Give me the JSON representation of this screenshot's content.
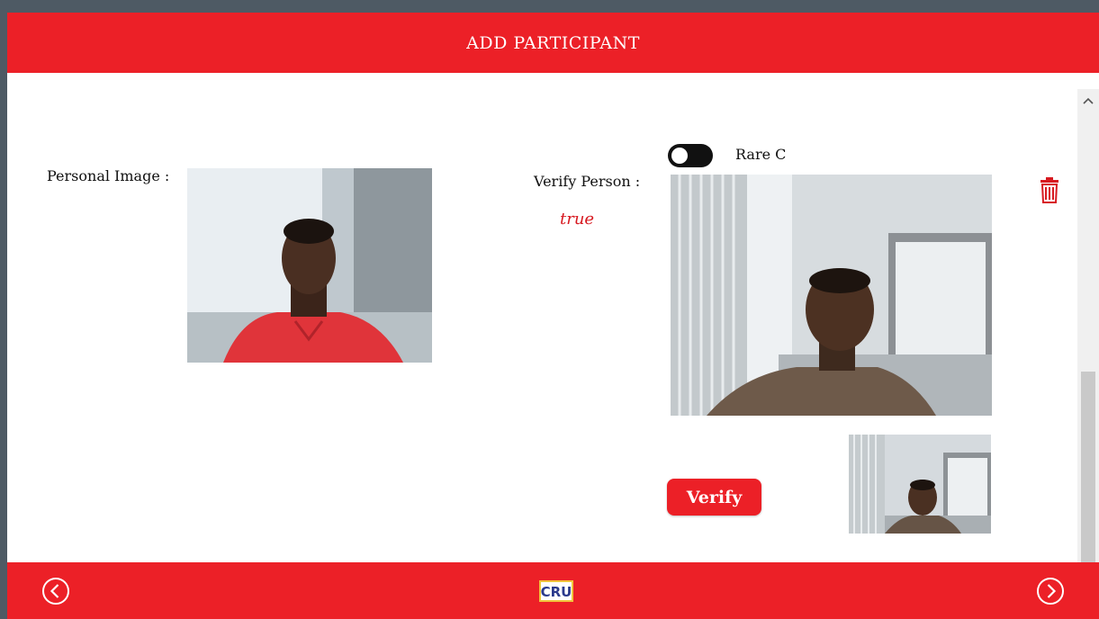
{
  "header": {
    "title": "ADD PARTICIPANT"
  },
  "form": {
    "personal_image_label": "Personal Image :",
    "verify_person_label": "Verify Person :",
    "verification_result": "true",
    "toggle": {
      "label": "Rare C",
      "state": "off"
    },
    "verify_button_label": "Verify"
  },
  "footer": {
    "logo_text": "CRU",
    "prev_icon": "chevron-left-circle-icon",
    "next_icon": "chevron-right-circle-icon"
  },
  "colors": {
    "brand_red": "#ec2027",
    "result_red": "#d71920",
    "toggle_dark": "#111111",
    "logo_blue": "#2b3a8c"
  },
  "icons": {
    "delete": "trash-icon",
    "scroll_up": "caret-up-icon"
  }
}
